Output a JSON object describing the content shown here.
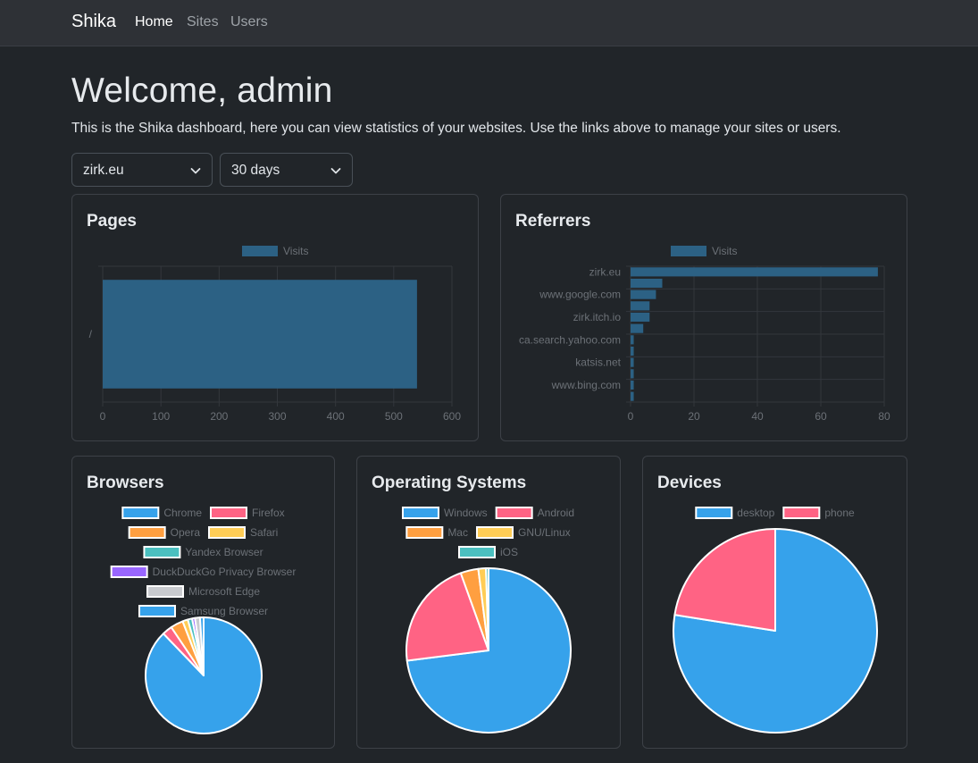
{
  "navbar": {
    "brand": "Shika",
    "links": [
      {
        "label": "Home",
        "active": true
      },
      {
        "label": "Sites",
        "active": false
      },
      {
        "label": "Users",
        "active": false
      }
    ]
  },
  "header": {
    "title": "Welcome, admin",
    "description": "This is the Shika dashboard, here you can view statistics of your websites. Use the links above to manage your sites or users."
  },
  "filters": {
    "site": {
      "selected": "zirk.eu"
    },
    "range": {
      "selected": "30 days"
    }
  },
  "cards": {
    "pages": {
      "title": "Pages"
    },
    "referrers": {
      "title": "Referrers"
    },
    "browsers": {
      "title": "Browsers"
    },
    "os": {
      "title": "Operating Systems"
    },
    "devices": {
      "title": "Devices"
    }
  },
  "colors": {
    "bar": "#2c6184",
    "grid": "#33373c",
    "tick": "#6c7177"
  },
  "chart_data": [
    {
      "id": "pages",
      "type": "bar",
      "orientation": "horizontal",
      "categories": [
        "/"
      ],
      "series": [
        {
          "name": "Visits",
          "values": [
            540
          ]
        }
      ],
      "xlim": [
        0,
        600
      ],
      "xticks": [
        0,
        100,
        200,
        300,
        400,
        500,
        600
      ],
      "legend": "top",
      "grid": true
    },
    {
      "id": "referrers",
      "type": "bar",
      "orientation": "horizontal",
      "categories": [
        "zirk.eu",
        "",
        "www.google.com",
        "",
        "zirk.itch.io",
        "",
        "ca.search.yahoo.com",
        "",
        "katsis.net",
        "",
        "www.bing.com",
        ""
      ],
      "series": [
        {
          "name": "Visits",
          "values": [
            78,
            10,
            8,
            6,
            6,
            4,
            1,
            1,
            1,
            1,
            1,
            1
          ]
        }
      ],
      "xlim": [
        0,
        80
      ],
      "xticks": [
        0,
        20,
        40,
        60,
        80
      ],
      "legend": "top",
      "grid": true
    },
    {
      "id": "browsers",
      "type": "pie",
      "labels": [
        "Chrome",
        "Firefox",
        "Opera",
        "Safari",
        "Yandex Browser",
        "DuckDuckGo Privacy Browser",
        "Microsoft Edge",
        "Samsung Browser"
      ],
      "values": [
        87.8,
        2.8,
        3.5,
        1.5,
        1.2,
        0.8,
        1.4,
        1.0
      ],
      "colors": [
        "#36a2eb",
        "#ff6384",
        "#ff9f40",
        "#ffcd56",
        "#4bc0c0",
        "#9966ff",
        "#c9cbcf",
        "#36a2eb"
      ],
      "legend": "top"
    },
    {
      "id": "os",
      "type": "pie",
      "labels": [
        "Windows",
        "Android",
        "Mac",
        "GNU/Linux",
        "iOS"
      ],
      "values": [
        73.0,
        21.5,
        3.5,
        1.5,
        0.5
      ],
      "colors": [
        "#36a2eb",
        "#ff6384",
        "#ff9f40",
        "#ffcd56",
        "#4bc0c0"
      ],
      "legend": "top"
    },
    {
      "id": "devices",
      "type": "pie",
      "labels": [
        "desktop",
        "phone"
      ],
      "values": [
        77.5,
        22.5
      ],
      "colors": [
        "#36a2eb",
        "#ff6384"
      ],
      "legend": "top"
    }
  ]
}
